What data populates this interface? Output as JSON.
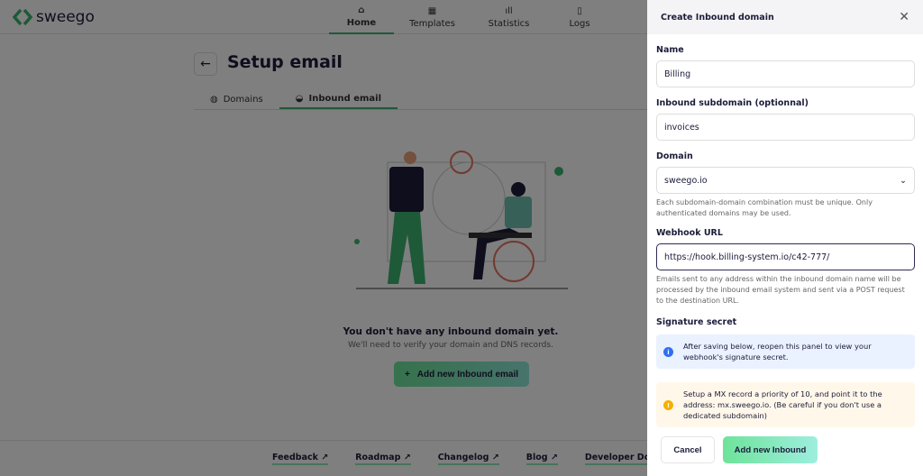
{
  "app": {
    "brand": "sweego"
  },
  "nav": [
    {
      "label": "Home",
      "icon": "home-icon"
    },
    {
      "label": "Templates",
      "icon": "layout-icon"
    },
    {
      "label": "Statistics",
      "icon": "bar-chart-icon"
    },
    {
      "label": "Logs",
      "icon": "clipboard-icon"
    }
  ],
  "page": {
    "title": "Setup email",
    "tabs": [
      {
        "label": "Domains",
        "icon": "globe-icon"
      },
      {
        "label": "Inbound email",
        "icon": "inbox-icon",
        "active": true
      }
    ]
  },
  "empty": {
    "title": "You don't have any inbound domain yet.",
    "subtitle": "We'll need to verify your domain and DNS records.",
    "button": "Add new Inbound email"
  },
  "footer": [
    "Feedback",
    "Roadmap",
    "Changelog",
    "Blog",
    "Developer Docs"
  ],
  "panel": {
    "title": "Create Inbound domain",
    "name_label": "Name",
    "name_value": "Billing",
    "sub_label": "Inbound subdomain (optionnal)",
    "sub_value": "invoices",
    "domain_label": "Domain",
    "domain_value": "sweego.io",
    "domain_help": "Each subdomain-domain combination must be unique. Only authenticated domains may be used.",
    "webhook_label": "Webhook URL",
    "webhook_value": "https://hook.billing-system.io/c42-777/",
    "webhook_help": "Emails sent to any address within the inbound domain name will be processed by the inbound email system and sent via a POST request to the destination URL.",
    "secret_label": "Signature secret",
    "info": "After saving below, reopen this panel to view your webhook's signature secret.",
    "warning": "Setup a MX record a priority of 10, and point it to the address: mx.sweego.io. (Be careful if you don't use a dedicated subdomain)",
    "cancel": "Cancel",
    "submit": "Add new Inbound"
  },
  "colors": {
    "accent": "#3cb371",
    "info": "#2f6fef",
    "warning": "#f5b000"
  }
}
